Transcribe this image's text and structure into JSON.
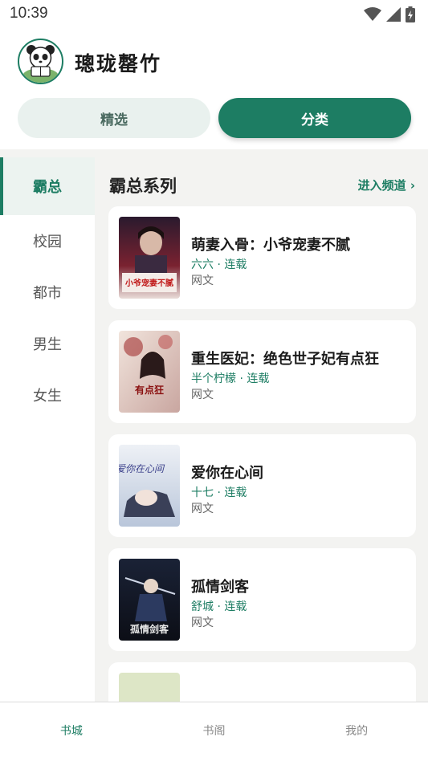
{
  "status": {
    "time": "10:39"
  },
  "app": {
    "title": "璁珑罄竹"
  },
  "tabs": [
    {
      "label": "精选",
      "active": false
    },
    {
      "label": "分类",
      "active": true
    }
  ],
  "sidebar": {
    "items": [
      {
        "label": "霸总",
        "active": true
      },
      {
        "label": "校园",
        "active": false
      },
      {
        "label": "都市",
        "active": false
      },
      {
        "label": "男生",
        "active": false
      },
      {
        "label": "女生",
        "active": false
      }
    ]
  },
  "section": {
    "title": "霸总系列",
    "link": "进入频道 ›"
  },
  "books": [
    {
      "title": "萌妻入骨：小爷宠妻不腻",
      "meta": "六六 · 连载",
      "source": "网文",
      "cover_text": "小爷宠妻不腻"
    },
    {
      "title": "重生医妃：绝色世子妃有点狂",
      "meta": "半个柠檬 · 连载",
      "source": "网文",
      "cover_text": "有点狂"
    },
    {
      "title": "爱你在心间",
      "meta": "十七 · 连载",
      "source": "网文",
      "cover_text": "爱你在心间"
    },
    {
      "title": "孤情剑客",
      "meta": "舒城 · 连载",
      "source": "网文",
      "cover_text": "孤情剑客"
    }
  ],
  "bottom_nav": [
    {
      "label": "书城",
      "active": true
    },
    {
      "label": "书阁",
      "active": false
    },
    {
      "label": "我的",
      "active": false
    }
  ],
  "colors": {
    "accent": "#1d7d63",
    "background": "#f3f3f1"
  }
}
